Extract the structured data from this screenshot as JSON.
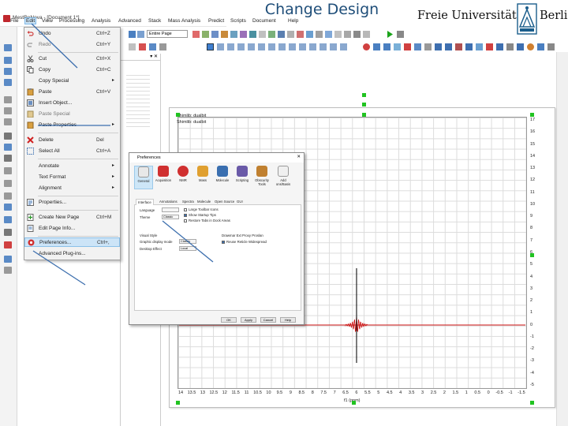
{
  "slide": {
    "title": "Change Design"
  },
  "logo": {
    "left_text": "Freie Universität",
    "right_text": "Berlin"
  },
  "window": {
    "title": "MestReNova - [Document 1*]"
  },
  "menubar": [
    "File",
    "Edit",
    "View",
    "Processing",
    "Analysis",
    "Advanced",
    "Stack",
    "Mass Analysis",
    "Predict",
    "Scripts",
    "Document",
    "Help"
  ],
  "toolbar": {
    "page_selector": "Entire Page"
  },
  "file_menu": {
    "items": [
      {
        "label": "Undo",
        "shortcut": "Ctrl+Z",
        "icon": "undo-icon"
      },
      {
        "label": "Redo",
        "shortcut": "Ctrl+Y",
        "icon": "redo-icon"
      },
      {
        "label": "Cut",
        "shortcut": "Ctrl+X",
        "icon": "cut-icon"
      },
      {
        "label": "Copy",
        "shortcut": "Ctrl+C",
        "icon": "copy-icon"
      },
      {
        "label": "Copy Special",
        "shortcut": "",
        "icon": "",
        "submenu": true
      },
      {
        "label": "Paste",
        "shortcut": "Ctrl+V",
        "icon": "paste-icon"
      },
      {
        "label": "Insert Object...",
        "shortcut": "",
        "icon": "insert-object-icon"
      },
      {
        "label": "Paste Special",
        "shortcut": "",
        "icon": "paste-special-icon"
      },
      {
        "label": "Paste Properties",
        "shortcut": "",
        "icon": "paste-properties-icon",
        "submenu": true
      },
      {
        "label": "Delete",
        "shortcut": "Del",
        "icon": "delete-icon"
      },
      {
        "label": "Select All",
        "shortcut": "Ctrl+A",
        "icon": "select-all-icon"
      },
      {
        "label": "Annotate",
        "shortcut": "",
        "icon": "",
        "submenu": true
      },
      {
        "label": "Text Format",
        "shortcut": "",
        "icon": "",
        "submenu": true
      },
      {
        "label": "Alignment",
        "shortcut": "",
        "icon": "",
        "submenu": true
      },
      {
        "label": "Properties...",
        "shortcut": "",
        "icon": "properties-icon"
      },
      {
        "label": "Create New Page",
        "shortcut": "Ctrl+M",
        "icon": "new-page-icon"
      },
      {
        "label": "Edit Page Info...",
        "shortcut": "",
        "icon": "page-info-icon"
      },
      {
        "label": "Preferences...",
        "shortcut": "Ctrl+,",
        "icon": "preferences-icon",
        "highlighted": true
      },
      {
        "label": "Advanced Plug-ins...",
        "shortcut": "",
        "icon": ""
      }
    ]
  },
  "spectrum": {
    "annotations": [
      "Shimlib: dualbit",
      "Shimlib: dualbit"
    ],
    "y_ticks": [
      "17",
      "16",
      "15",
      "14",
      "13",
      "12",
      "11",
      "10",
      "9",
      "8",
      "7",
      "6",
      "5",
      "4",
      "3",
      "2",
      "1",
      "0",
      "-1",
      "-2",
      "-3",
      "-4",
      "-5"
    ],
    "x_ticks": [
      "14",
      "13.5",
      "13",
      "12.5",
      "12",
      "11.5",
      "11",
      "10.5",
      "10",
      "9.5",
      "9",
      "8.5",
      "8",
      "7.5",
      "7",
      "6.5",
      "6",
      "5.5",
      "5",
      "4.5",
      "4",
      "3.5",
      "3",
      "2.5",
      "2",
      "1.5",
      "1",
      "0.5",
      "0",
      "-0.5",
      "-1",
      "-1.5"
    ],
    "x_label": "f1 (ppm)",
    "peak_ppm": 6.0,
    "line_color": "#cc1111"
  },
  "preferences": {
    "title": "Preferences",
    "categories": [
      "General",
      "Acquisition",
      "NMR",
      "Mass",
      "Molecule",
      "Scripting",
      "Obscurity Tools",
      "Add ons/Basis"
    ],
    "subtabs": [
      "Interface",
      "Annotations",
      "Spectra",
      "Molecule",
      "Open Source",
      "GUI"
    ],
    "labels": {
      "language": "Language",
      "theme": "Theme",
      "theme_value": "Classic",
      "visual_style": "Visual Style",
      "graphic_style": "Graphic display mode",
      "graphic_style_value": "Classic",
      "desktop_effect": "Desktop Effect",
      "desktop_effect_value": "Local",
      "check_large": "Large Toolbar Icons",
      "check_show_tips": "Show Startup Tips",
      "check_table": "Restore Tabs in Dock Areas",
      "gen_heading": "Drawmar Ext Proxy Proslan",
      "gen_check": "Reuse Reticle Widespread"
    },
    "buttons": [
      "OK",
      "Apply",
      "Cancel",
      "Help"
    ]
  }
}
